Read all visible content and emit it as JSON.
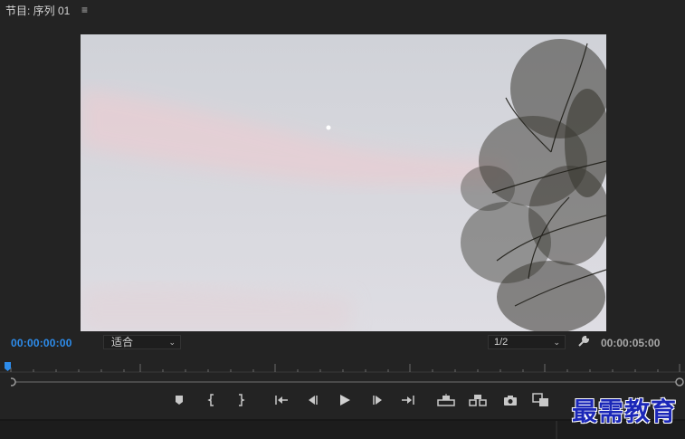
{
  "panel": {
    "title": "节目: 序列 01",
    "menu_icon": "hamburger-menu-icon"
  },
  "controls": {
    "timecode_current": "00:00:00:00",
    "zoom_value": "适合",
    "resolution_value": "1/2",
    "settings_icon": "wrench-icon",
    "timecode_duration": "00:00:05:00"
  },
  "transport": {
    "buttons": [
      {
        "name": "add-marker-button",
        "icon": "marker-icon"
      },
      {
        "name": "mark-in-button",
        "icon": "mark-in-icon"
      },
      {
        "name": "mark-out-button",
        "icon": "mark-out-icon"
      },
      {
        "name": "go-to-in-button",
        "icon": "go-to-in-icon"
      },
      {
        "name": "step-back-button",
        "icon": "step-back-icon"
      },
      {
        "name": "play-button",
        "icon": "play-icon"
      },
      {
        "name": "step-forward-button",
        "icon": "step-forward-icon"
      },
      {
        "name": "go-to-out-button",
        "icon": "go-to-out-icon"
      },
      {
        "name": "lift-button",
        "icon": "lift-icon"
      },
      {
        "name": "extract-button",
        "icon": "extract-icon"
      },
      {
        "name": "export-frame-button",
        "icon": "camera-icon"
      },
      {
        "name": "compare-view-button",
        "icon": "compare-icon"
      }
    ]
  },
  "watermark": {
    "text": "最需教育"
  },
  "colors": {
    "timecode_accent": "#2d8ceb",
    "background": "#232323",
    "watermark": "#1b27b8"
  }
}
